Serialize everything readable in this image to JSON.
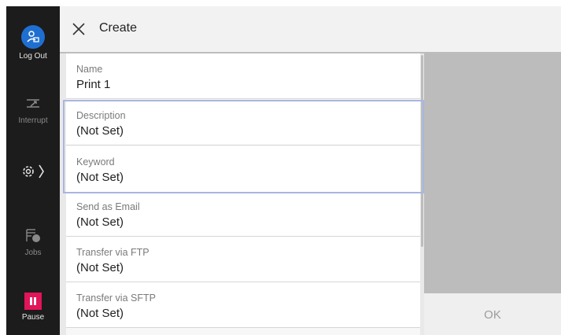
{
  "sidebar": {
    "logout_label": "Log Out",
    "interrupt_label": "Interrupt",
    "jobs_label": "Jobs",
    "pause_label": "Pause",
    "accent_color": "#1f6fd1",
    "pause_color": "#e2145a"
  },
  "header": {
    "title": "Create"
  },
  "fields": [
    {
      "label": "Name",
      "value": "Print 1"
    },
    {
      "label": "Description",
      "value": "(Not Set)"
    },
    {
      "label": "Keyword",
      "value": "(Not Set)"
    },
    {
      "label": "Send as Email",
      "value": "(Not Set)"
    },
    {
      "label": "Transfer via FTP",
      "value": "(Not Set)"
    },
    {
      "label": "Transfer via SFTP",
      "value": "(Not Set)"
    }
  ],
  "ok_button": {
    "label": "OK"
  }
}
